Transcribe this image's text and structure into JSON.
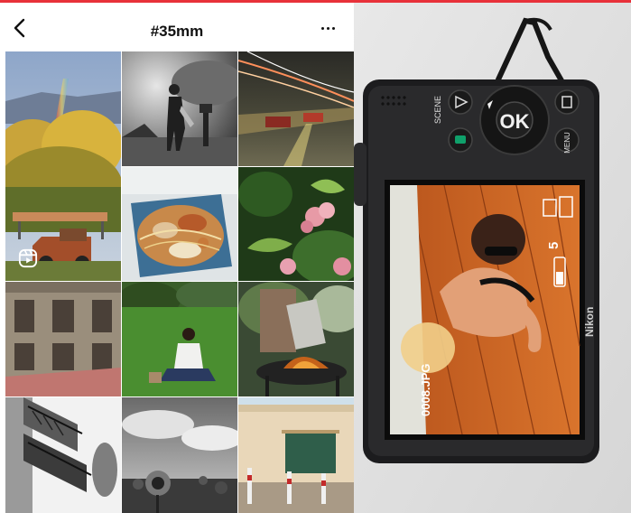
{
  "phone": {
    "title": "#35mm",
    "back_icon": "chevron-left-icon",
    "more_icon": "more-horizontal-icon",
    "reels_icon": "reels-icon"
  },
  "camera": {
    "scene_label": "SCENE",
    "ok_label": "OK",
    "menu_label": "MENU",
    "file_label": "0008.JPG",
    "brand": "Nikon",
    "shots_remaining": "5",
    "battery_icon": "battery-icon"
  },
  "colors": {
    "accent": "#e8313a",
    "camera_body": "#1c1c1e",
    "grass": "#3f7f2b"
  }
}
